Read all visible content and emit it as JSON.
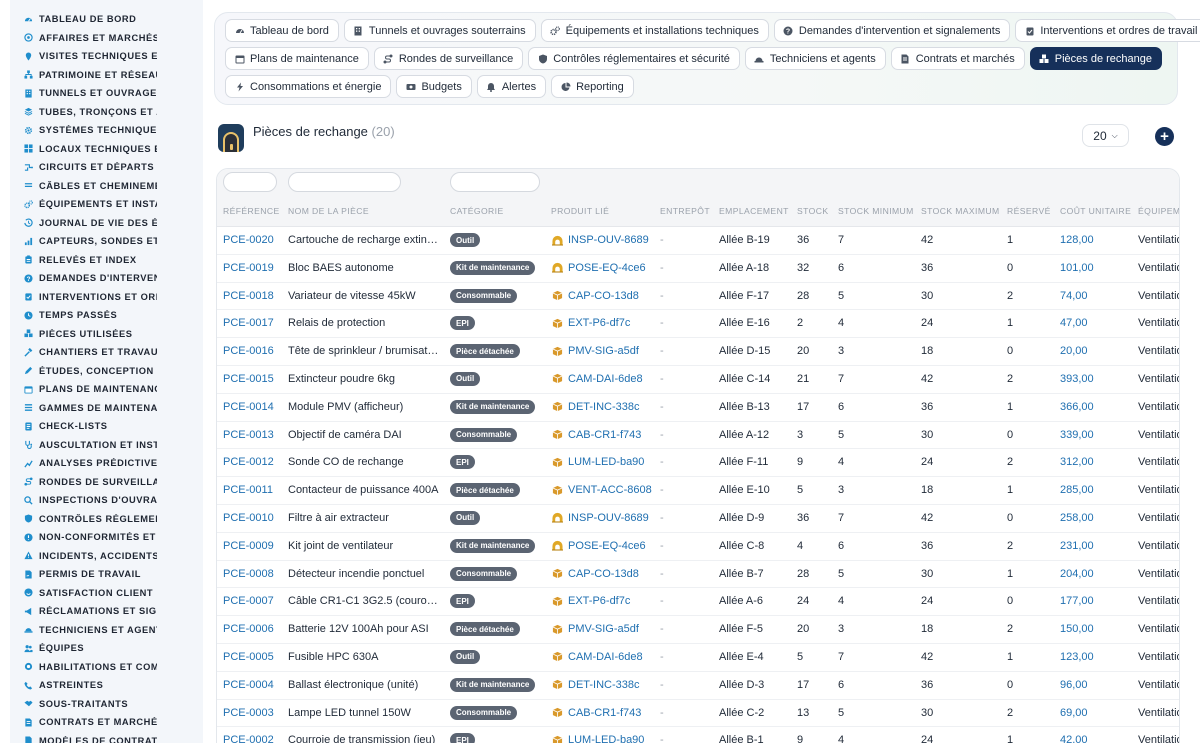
{
  "sidebar": {
    "items": [
      {
        "label": "TABLEAU DE BORD",
        "icon": "gauge-icon"
      },
      {
        "label": "AFFAIRES ET MARCHÉS",
        "icon": "target-icon"
      },
      {
        "label": "VISITES TECHNIQUES ET",
        "icon": "map-pin-icon"
      },
      {
        "label": "PATRIMOINE ET RÉSEAUX",
        "icon": "network-icon"
      },
      {
        "label": "TUNNELS ET OUVRAGES",
        "icon": "building-icon"
      },
      {
        "label": "TUBES, TRONÇONS ET ZO",
        "icon": "layers-icon"
      },
      {
        "label": "SYSTÈMES TECHNIQUES",
        "icon": "cogs-icon"
      },
      {
        "label": "LOCAUX TECHNIQUES ET",
        "icon": "grid-icon"
      },
      {
        "label": "CIRCUITS ET DÉPARTS É",
        "icon": "circuit-icon"
      },
      {
        "label": "CÂBLES ET CHEMINEMEN",
        "icon": "cable-icon"
      },
      {
        "label": "ÉQUIPEMENTS ET INSTAL",
        "icon": "gears-icon"
      },
      {
        "label": "JOURNAL DE VIE DES ÉQ",
        "icon": "history-icon"
      },
      {
        "label": "CAPTEURS, SONDES ET C",
        "icon": "signal-icon"
      },
      {
        "label": "RELEVÉS ET INDEX",
        "icon": "clipboard-icon"
      },
      {
        "label": "DEMANDES D'INTERVENT",
        "icon": "question-circle-icon"
      },
      {
        "label": "INTERVENTIONS ET ORDI",
        "icon": "clipboard-check-icon"
      },
      {
        "label": "TEMPS PASSÉS",
        "icon": "clock-icon"
      },
      {
        "label": "PIÈCES UTILISÉES",
        "icon": "boxes-icon"
      },
      {
        "label": "CHANTIERS ET TRAVAUX",
        "icon": "hammer-icon"
      },
      {
        "label": "ÉTUDES, CONCEPTION ET",
        "icon": "pencil-icon"
      },
      {
        "label": "PLANS DE MAINTENANCE",
        "icon": "calendar-icon"
      },
      {
        "label": "GAMMES DE MAINTENAN",
        "icon": "list-icon"
      },
      {
        "label": "CHECK-LISTS",
        "icon": "checklist-icon"
      },
      {
        "label": "AUSCULTATION ET INSTR",
        "icon": "stethoscope-icon"
      },
      {
        "label": "ANALYSES PRÉDICTIVES",
        "icon": "chart-icon"
      },
      {
        "label": "RONDES DE SURVEILLAN",
        "icon": "route-icon"
      },
      {
        "label": "INSPECTIONS D'OUVRAG",
        "icon": "search-icon"
      },
      {
        "label": "CONTRÔLES RÉGLEMENT",
        "icon": "shield-icon"
      },
      {
        "label": "NON-CONFORMITÉS ET A",
        "icon": "alert-circle-icon"
      },
      {
        "label": "INCIDENTS, ACCIDENTS E",
        "icon": "warning-icon"
      },
      {
        "label": "PERMIS DE TRAVAIL",
        "icon": "file-signature-icon"
      },
      {
        "label": "SATISFACTION CLIENT",
        "icon": "smile-icon"
      },
      {
        "label": "RÉCLAMATIONS ET SIGN",
        "icon": "megaphone-icon"
      },
      {
        "label": "TECHNICIENS ET AGENTS",
        "icon": "hard-hat-icon"
      },
      {
        "label": "ÉQUIPES",
        "icon": "users-icon"
      },
      {
        "label": "HABILITATIONS ET COMP",
        "icon": "badge-icon"
      },
      {
        "label": "ASTREINTES",
        "icon": "phone-icon"
      },
      {
        "label": "SOUS-TRAITANTS",
        "icon": "handshake-icon"
      },
      {
        "label": "CONTRATS ET MARCHÉS",
        "icon": "file-contract-icon"
      },
      {
        "label": "MODÈLES DE CONTRATS",
        "icon": "file-icon"
      }
    ]
  },
  "topnav": {
    "rows": [
      [
        {
          "label": "Tableau de bord",
          "icon": "gauge-icon"
        },
        {
          "label": "Tunnels et ouvrages souterrains",
          "icon": "building-icon"
        },
        {
          "label": "Équipements et installations techniques",
          "icon": "gears-icon"
        },
        {
          "label": "Demandes d'intervention et signalements",
          "icon": "question-circle-icon"
        },
        {
          "label": "Interventions et ordres de travail",
          "icon": "clipboard-check-icon"
        }
      ],
      [
        {
          "label": "Plans de maintenance",
          "icon": "calendar-icon"
        },
        {
          "label": "Rondes de surveillance",
          "icon": "route-icon"
        },
        {
          "label": "Contrôles réglementaires et sécurité",
          "icon": "shield-icon"
        },
        {
          "label": "Techniciens et agents",
          "icon": "hard-hat-icon"
        },
        {
          "label": "Contrats et marchés",
          "icon": "file-contract-icon"
        },
        {
          "label": "Pièces de rechange",
          "icon": "boxes-icon",
          "active": true
        }
      ],
      [
        {
          "label": "Consommations et énergie",
          "icon": "bolt-icon"
        },
        {
          "label": "Budgets",
          "icon": "money-icon"
        },
        {
          "label": "Alertes",
          "icon": "bell-icon"
        },
        {
          "label": "Reporting",
          "icon": "pie-chart-icon"
        }
      ]
    ]
  },
  "page": {
    "title": "Pièces de rechange",
    "count": "(20)",
    "page_size": "20",
    "add_label": "+"
  },
  "table": {
    "columns": [
      "RÉFÉRENCE",
      "NOM DE LA PIÈCE",
      "CATÉGORIE",
      "PRODUIT LIÉ",
      "ENTREPÔT",
      "EMPLACEMENT",
      "STOCK",
      "STOCK MINIMUM",
      "STOCK MAXIMUM",
      "RÉSERVÉ",
      "COÛT UNITAIRE",
      "ÉQUIPEM"
    ],
    "rows": [
      {
        "ref": "PCE-0020",
        "name": "Cartouche de recharge extinc…",
        "cat": "Outil",
        "prod_icon": "tunnel-icon",
        "prod": "INSP-OUV-8689",
        "wh": "-",
        "loc": "Allée B-19",
        "stock": "36",
        "min": "7",
        "max": "42",
        "res": "1",
        "cost": "128,00",
        "equip": "Ventilatio"
      },
      {
        "ref": "PCE-0019",
        "name": "Bloc BAES autonome",
        "cat": "Kit de maintenance",
        "prod_icon": "tunnel-icon",
        "prod": "POSE-EQ-4ce6",
        "wh": "-",
        "loc": "Allée A-18",
        "stock": "32",
        "min": "6",
        "max": "36",
        "res": "0",
        "cost": "101,00",
        "equip": "Ventilatio"
      },
      {
        "ref": "PCE-0018",
        "name": "Variateur de vitesse 45kW",
        "cat": "Consommable",
        "prod_icon": "box-icon",
        "prod": "CAP-CO-13d8",
        "wh": "-",
        "loc": "Allée F-17",
        "stock": "28",
        "min": "5",
        "max": "30",
        "res": "2",
        "cost": "74,00",
        "equip": "Ventilatio"
      },
      {
        "ref": "PCE-0017",
        "name": "Relais de protection",
        "cat": "EPI",
        "prod_icon": "box-icon",
        "prod": "EXT-P6-df7c",
        "wh": "-",
        "loc": "Allée E-16",
        "stock": "2",
        "min": "4",
        "max": "24",
        "res": "1",
        "cost": "47,00",
        "equip": "Ventilatio"
      },
      {
        "ref": "PCE-0016",
        "name": "Tête de sprinkleur / brumisation",
        "cat": "Pièce détachée",
        "prod_icon": "box-icon",
        "prod": "PMV-SIG-a5df",
        "wh": "-",
        "loc": "Allée D-15",
        "stock": "20",
        "min": "3",
        "max": "18",
        "res": "0",
        "cost": "20,00",
        "equip": "Ventilatio"
      },
      {
        "ref": "PCE-0015",
        "name": "Extincteur poudre 6kg",
        "cat": "Outil",
        "prod_icon": "box-icon",
        "prod": "CAM-DAI-6de8",
        "wh": "-",
        "loc": "Allée C-14",
        "stock": "21",
        "min": "7",
        "max": "42",
        "res": "2",
        "cost": "393,00",
        "equip": "Ventilatio"
      },
      {
        "ref": "PCE-0014",
        "name": "Module PMV (afficheur)",
        "cat": "Kit de maintenance",
        "prod_icon": "box-icon",
        "prod": "DET-INC-338c",
        "wh": "-",
        "loc": "Allée B-13",
        "stock": "17",
        "min": "6",
        "max": "36",
        "res": "1",
        "cost": "366,00",
        "equip": "Ventilatio"
      },
      {
        "ref": "PCE-0013",
        "name": "Objectif de caméra DAI",
        "cat": "Consommable",
        "prod_icon": "box-icon",
        "prod": "CAB-CR1-f743",
        "wh": "-",
        "loc": "Allée A-12",
        "stock": "3",
        "min": "5",
        "max": "30",
        "res": "0",
        "cost": "339,00",
        "equip": "Ventilatio"
      },
      {
        "ref": "PCE-0012",
        "name": "Sonde CO de rechange",
        "cat": "EPI",
        "prod_icon": "box-icon",
        "prod": "LUM-LED-ba90",
        "wh": "-",
        "loc": "Allée F-11",
        "stock": "9",
        "min": "4",
        "max": "24",
        "res": "2",
        "cost": "312,00",
        "equip": "Ventilatio"
      },
      {
        "ref": "PCE-0011",
        "name": "Contacteur de puissance 400A",
        "cat": "Pièce détachée",
        "prod_icon": "box-icon",
        "prod": "VENT-ACC-8608",
        "wh": "-",
        "loc": "Allée E-10",
        "stock": "5",
        "min": "3",
        "max": "18",
        "res": "1",
        "cost": "285,00",
        "equip": "Ventilatio"
      },
      {
        "ref": "PCE-0010",
        "name": "Filtre à air extracteur",
        "cat": "Outil",
        "prod_icon": "tunnel-icon",
        "prod": "INSP-OUV-8689",
        "wh": "-",
        "loc": "Allée D-9",
        "stock": "36",
        "min": "7",
        "max": "42",
        "res": "0",
        "cost": "258,00",
        "equip": "Ventilatio"
      },
      {
        "ref": "PCE-0009",
        "name": "Kit joint de ventilateur",
        "cat": "Kit de maintenance",
        "prod_icon": "tunnel-icon",
        "prod": "POSE-EQ-4ce6",
        "wh": "-",
        "loc": "Allée C-8",
        "stock": "4",
        "min": "6",
        "max": "36",
        "res": "2",
        "cost": "231,00",
        "equip": "Ventilatio"
      },
      {
        "ref": "PCE-0008",
        "name": "Détecteur incendie ponctuel",
        "cat": "Consommable",
        "prod_icon": "box-icon",
        "prod": "CAP-CO-13d8",
        "wh": "-",
        "loc": "Allée B-7",
        "stock": "28",
        "min": "5",
        "max": "30",
        "res": "1",
        "cost": "204,00",
        "equip": "Ventilatio"
      },
      {
        "ref": "PCE-0007",
        "name": "Câble CR1-C1 3G2.5 (couronne)",
        "cat": "EPI",
        "prod_icon": "box-icon",
        "prod": "EXT-P6-df7c",
        "wh": "-",
        "loc": "Allée A-6",
        "stock": "24",
        "min": "4",
        "max": "24",
        "res": "0",
        "cost": "177,00",
        "equip": "Ventilatio"
      },
      {
        "ref": "PCE-0006",
        "name": "Batterie 12V 100Ah pour ASI",
        "cat": "Pièce détachée",
        "prod_icon": "box-icon",
        "prod": "PMV-SIG-a5df",
        "wh": "-",
        "loc": "Allée F-5",
        "stock": "20",
        "min": "3",
        "max": "18",
        "res": "2",
        "cost": "150,00",
        "equip": "Ventilatio"
      },
      {
        "ref": "PCE-0005",
        "name": "Fusible HPC 630A",
        "cat": "Outil",
        "prod_icon": "box-icon",
        "prod": "CAM-DAI-6de8",
        "wh": "-",
        "loc": "Allée E-4",
        "stock": "5",
        "min": "7",
        "max": "42",
        "res": "1",
        "cost": "123,00",
        "equip": "Ventilatio"
      },
      {
        "ref": "PCE-0004",
        "name": "Ballast électronique (unité)",
        "cat": "Kit de maintenance",
        "prod_icon": "box-icon",
        "prod": "DET-INC-338c",
        "wh": "-",
        "loc": "Allée D-3",
        "stock": "17",
        "min": "6",
        "max": "36",
        "res": "0",
        "cost": "96,00",
        "equip": "Ventilatio"
      },
      {
        "ref": "PCE-0003",
        "name": "Lampe LED tunnel 150W",
        "cat": "Consommable",
        "prod_icon": "box-icon",
        "prod": "CAB-CR1-f743",
        "wh": "-",
        "loc": "Allée C-2",
        "stock": "13",
        "min": "5",
        "max": "30",
        "res": "2",
        "cost": "69,00",
        "equip": "Ventilatio"
      },
      {
        "ref": "PCE-0002",
        "name": "Courroie de transmission (jeu)",
        "cat": "EPI",
        "prod_icon": "box-icon",
        "prod": "LUM-LED-ba90",
        "wh": "-",
        "loc": "Allée B-1",
        "stock": "9",
        "min": "4",
        "max": "24",
        "res": "1",
        "cost": "42,00",
        "equip": "Ventilatio"
      }
    ]
  },
  "colors": {
    "accent": "#16305a",
    "link": "#1f6fb0",
    "badge": "#5b6472",
    "sidebar_icon": "#1f8ecc",
    "tunnel_icon": "#e0a826",
    "box_icon": "#d9992b"
  }
}
